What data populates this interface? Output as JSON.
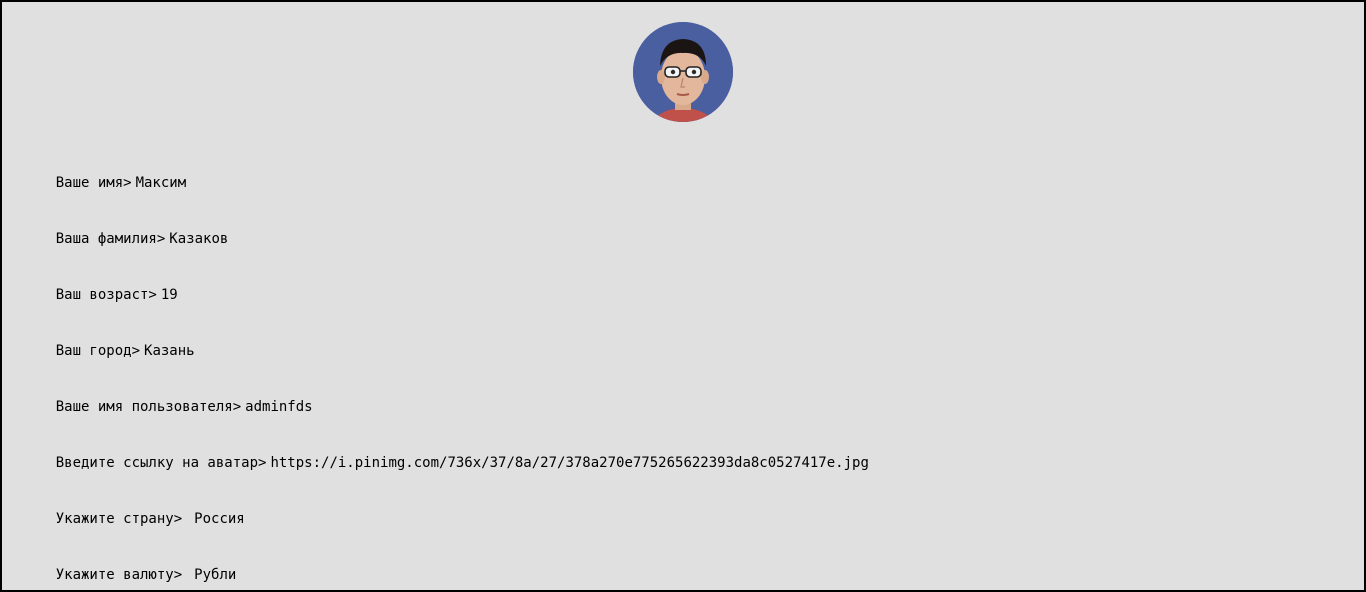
{
  "avatar": {
    "icon": "user-avatar-photo",
    "bg": "#4a5fa0"
  },
  "fields": [
    {
      "prompt": "Ваше имя>",
      "value": "Максим"
    },
    {
      "prompt": "Ваша фамилия>",
      "value": "Казаков"
    },
    {
      "prompt": "Ваш возраст>",
      "value": "19"
    },
    {
      "prompt": "Ваш город>",
      "value": "Казань"
    },
    {
      "prompt": "Ваше имя пользователя>",
      "value": "adminfds"
    },
    {
      "prompt": "Введите ссылку на аватар>",
      "value": "https://i.pinimg.com/736x/37/8a/27/378a270e775265622393da8c0527417e.jpg"
    },
    {
      "prompt": "Укажите страну>",
      "value": "Россия"
    },
    {
      "prompt": "Укажите валюту>",
      "value": "Рубли"
    }
  ]
}
